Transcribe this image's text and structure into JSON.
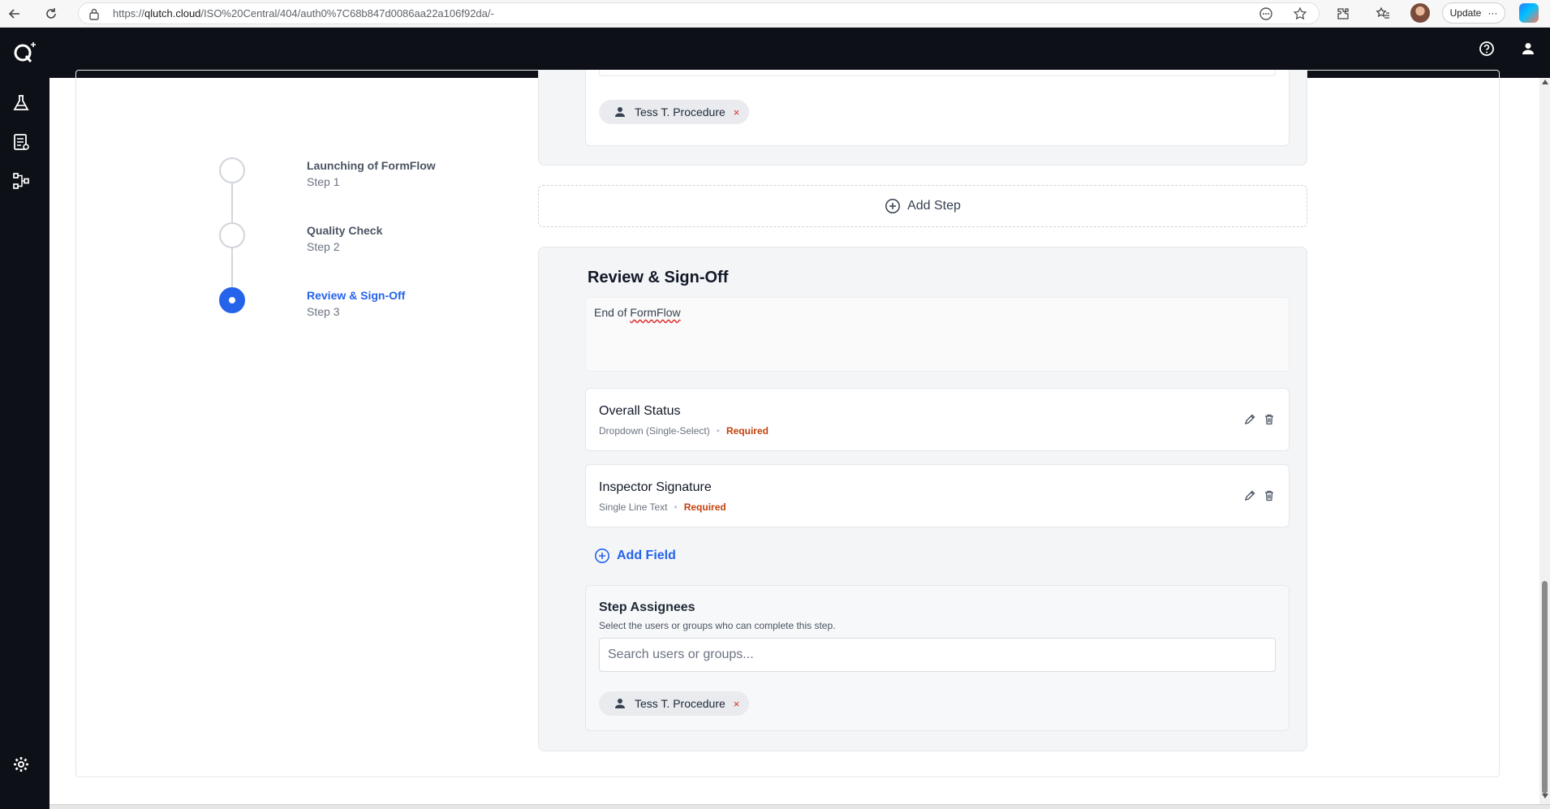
{
  "browser": {
    "url_prefix": "https://",
    "url_host": "qlutch.cloud",
    "url_path": "/ISO%20Central/404/auth0%7C68b847d0086aa22a106f92da/-",
    "update_label": "Update",
    "more_label": "···"
  },
  "stepper": {
    "steps": [
      {
        "title": "Launching of FormFlow",
        "sub": "Step 1"
      },
      {
        "title": "Quality Check",
        "sub": "Step 2"
      },
      {
        "title": "Review & Sign-Off",
        "sub": "Step 3"
      }
    ]
  },
  "previous_step": {
    "assignee_chip": "Tess T. Procedure",
    "remove_label": "×"
  },
  "add_step_label": "Add Step",
  "current_step": {
    "title": "Review & Sign-Off",
    "description_prefix": "End of ",
    "description_word": "FormFlow",
    "fields": [
      {
        "name": "Overall Status",
        "type": "Dropdown (Single-Select)",
        "separator": "•",
        "required": "Required"
      },
      {
        "name": "Inspector Signature",
        "type": "Single Line Text",
        "separator": "•",
        "required": "Required"
      }
    ],
    "add_field_label": "Add Field",
    "assignees": {
      "title": "Step Assignees",
      "subtitle": "Select the users or groups who can complete this step.",
      "search_placeholder": "Search users or groups...",
      "chip": "Tess T. Procedure",
      "remove_label": "×"
    }
  },
  "colors": {
    "header_bg": "#0d1117",
    "accent": "#2563eb",
    "required": "#c2410c",
    "remove": "#dc2626"
  },
  "icons": {
    "back": "arrow-left-icon",
    "reload": "reload-icon",
    "lock": "lock-icon",
    "rail": [
      "flask-icon",
      "document-list-icon",
      "workflow-icon",
      "gear-icon"
    ],
    "header": [
      "help-icon",
      "user-icon"
    ],
    "field_actions": [
      "pencil-icon",
      "trash-icon"
    ]
  }
}
